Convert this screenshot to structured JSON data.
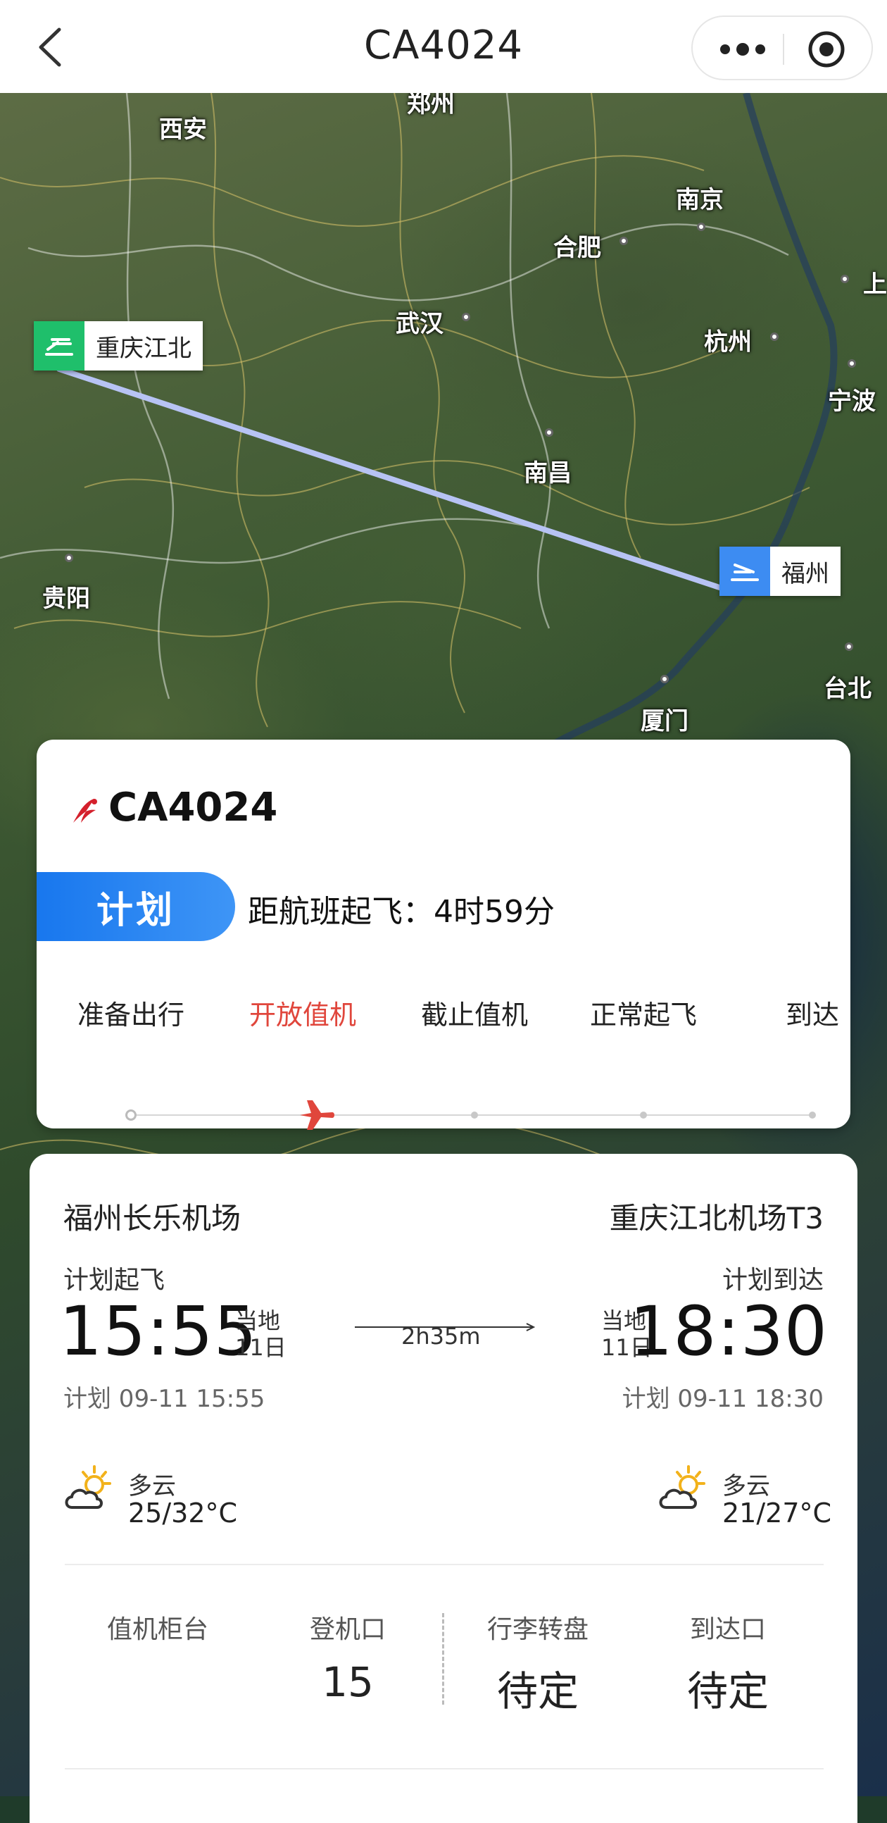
{
  "topbar": {
    "title": "CA4024"
  },
  "map": {
    "cities": [
      {
        "name": "郑州",
        "label": "郑州"
      },
      {
        "name": "西安",
        "label": "西安"
      },
      {
        "name": "南京",
        "label": "南京"
      },
      {
        "name": "合肥",
        "label": "合肥"
      },
      {
        "name": "上",
        "label": "上"
      },
      {
        "name": "武汉",
        "label": "武汉"
      },
      {
        "name": "杭州",
        "label": "杭州"
      },
      {
        "name": "宁波",
        "label": "宁波"
      },
      {
        "name": "南昌",
        "label": "南昌"
      },
      {
        "name": "贵阳",
        "label": "贵阳"
      },
      {
        "name": "台北",
        "label": "台北"
      },
      {
        "name": "厦门",
        "label": "厦门"
      }
    ],
    "origin_tag": "重庆江北",
    "dest_tag": "福州",
    "route_color": "#b7c3f4",
    "origin_color": "#1fbf6b",
    "dest_color": "#3d8cf2"
  },
  "status": {
    "flight_no": "CA4024",
    "state": "计划",
    "countdown": "距航班起飞：4时59分",
    "steps": [
      "准备出行",
      "开放值机",
      "截止值机",
      "正常起飞",
      "到达"
    ],
    "active_step": 1,
    "accent": "#e0463c"
  },
  "detail": {
    "dep_airport": "福州长乐机场",
    "arr_airport": "重庆江北机场T3",
    "dep_label": "计划起飞",
    "arr_label": "计划到达",
    "dep_time": "15:55",
    "arr_time": "18:30",
    "local_1": "当地",
    "local_2": "11日",
    "duration": "2h35m",
    "dep_sched": "计划 09-11 15:55",
    "arr_sched": "计划 09-11 18:30",
    "dep_weather": "多云",
    "dep_temp": "25/32°C",
    "arr_weather": "多云",
    "arr_temp": "21/27°C",
    "info": [
      {
        "label": "值机柜台",
        "value": ""
      },
      {
        "label": "登机口",
        "value": "15"
      },
      {
        "label": "行李转盘",
        "value": "待定"
      },
      {
        "label": "到达口",
        "value": "待定"
      }
    ]
  }
}
